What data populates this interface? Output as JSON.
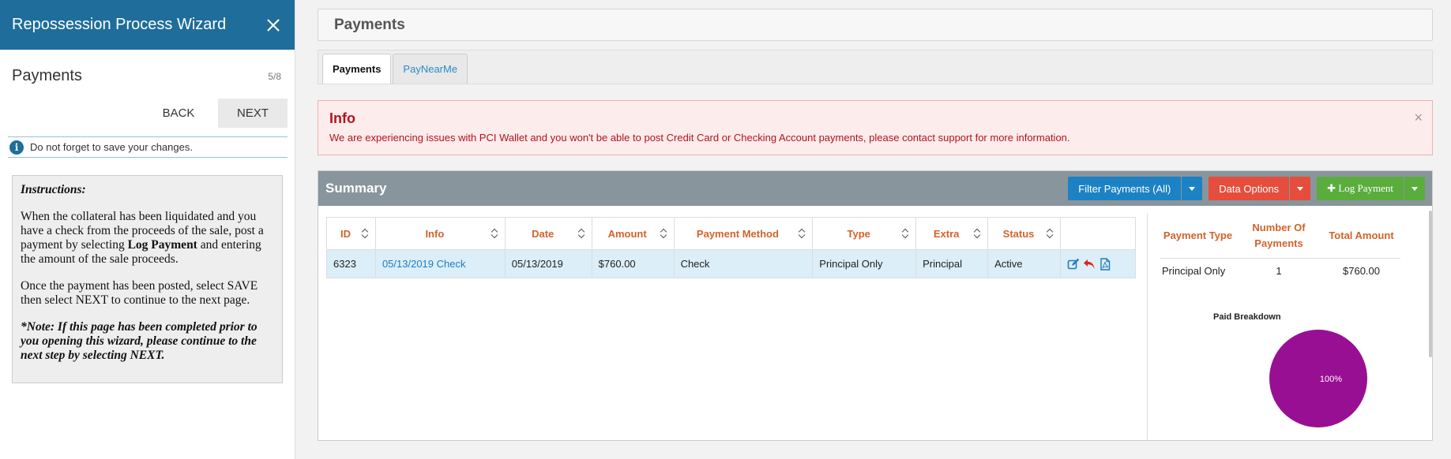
{
  "wizard": {
    "title": "Repossession Process Wizard",
    "step_title": "Payments",
    "step_count": "5/8",
    "back_label": "BACK",
    "next_label": "NEXT",
    "notice": "Do not forget to save your changes.",
    "instructions": {
      "heading": "Instructions:",
      "p1_before": "When the collateral has been liquidated and you have a check from the proceeds of the sale, post a payment by selecting ",
      "p1_bold": "Log Payment",
      "p1_after": " and entering the amount of the sale proceeds.",
      "p2": "Once the payment has been posted, select SAVE then select NEXT to continue to the next page.",
      "note": "*Note: If this page has been completed prior to you opening this wizard, please continue to the next step by selecting NEXT."
    }
  },
  "page": {
    "title": "Payments",
    "tabs": [
      {
        "label": "Payments",
        "active": true
      },
      {
        "label": "PayNearMe",
        "active": false
      }
    ]
  },
  "alert": {
    "title": "Info",
    "text": "We are experiencing issues with PCI Wallet and you won't be able to post Credit Card or Checking Account payments, please contact support for more information.",
    "close": "×"
  },
  "summary": {
    "title": "Summary",
    "filter_label": "Filter Payments (All)",
    "data_options_label": "Data Options",
    "log_payment_label": "✚ Log Payment",
    "columns": [
      "ID",
      "Info",
      "Date",
      "Amount",
      "Payment Method",
      "Type",
      "Extra",
      "Status"
    ],
    "rows": [
      {
        "id": "6323",
        "info": "05/13/2019 Check",
        "date": "05/13/2019",
        "amount": "$760.00",
        "method": "Check",
        "type": "Principal Only",
        "extra": "Principal",
        "status": "Active"
      }
    ]
  },
  "breakdown": {
    "columns": [
      "Payment Type",
      "Number Of Payments",
      "Total Amount"
    ],
    "rows": [
      {
        "type": "Principal Only",
        "count": "1",
        "total": "$760.00"
      }
    ],
    "chart_title": "Paid Breakdown"
  },
  "chart_data": {
    "type": "pie",
    "title": "Paid Breakdown",
    "categories": [
      "Principal Only"
    ],
    "values": [
      100
    ],
    "labels": [
      "100%"
    ],
    "colors": [
      "#990f93"
    ]
  },
  "colors": {
    "wizard_header": "#1f6d9b",
    "accent_orange": "#d4622a",
    "alert_red": "#b5121b",
    "filter_blue": "#1c82c4",
    "data_options_red": "#e54d3c",
    "log_payment_green": "#5aad3d",
    "pie_purple": "#990f93"
  },
  "icons": [
    "close-icon",
    "info-icon",
    "sort-icon",
    "edit-icon",
    "reverse-icon",
    "pdf-icon",
    "caret-down-icon",
    "plus-icon"
  ]
}
